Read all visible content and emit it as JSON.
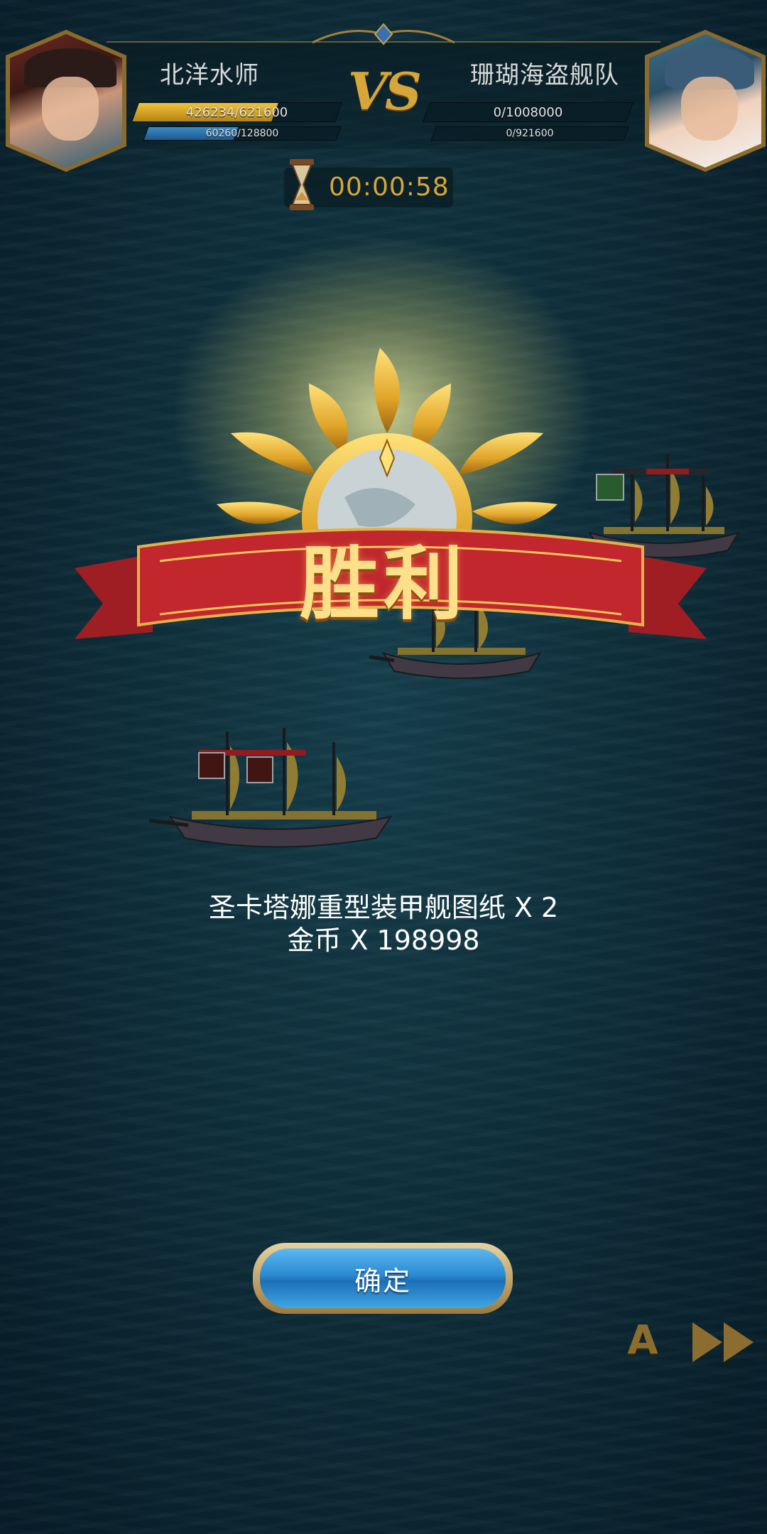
{
  "header": {
    "left_team": {
      "name": "北洋水师",
      "hp_text": "426234/621600",
      "hp": 0.686,
      "sub_text": "60260/128800",
      "sub": 0.468
    },
    "vs_label": "VS",
    "right_team": {
      "name": "珊瑚海盗舰队",
      "hp_text": "0/1008000",
      "hp": 0,
      "sub_text": "0/921600",
      "sub": 0
    },
    "timer": "00:00:58"
  },
  "result": {
    "title": "胜利"
  },
  "rewards": [
    "圣卡塔娜重型装甲舰图纸 X 2",
    "金币 X 198998"
  ],
  "buttons": {
    "confirm": "确定",
    "auto": "A"
  },
  "colors": {
    "gold": "#d8a636",
    "banner_red": "#b3232a",
    "sea": "#17414e",
    "button_blue": "#2b89d0"
  },
  "icons": [
    "hourglass-icon",
    "sun-emblem-icon",
    "fast-forward-icon"
  ]
}
